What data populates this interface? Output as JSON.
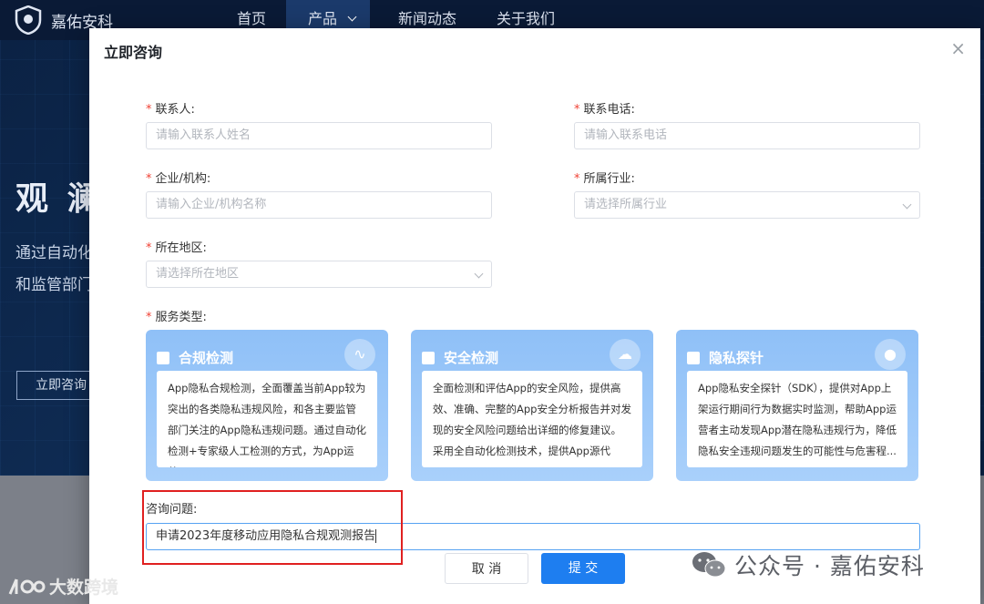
{
  "site": {
    "brand": "嘉佑安科",
    "nav": [
      "首页",
      "产品",
      "新闻动态",
      "关于我们"
    ],
    "hero_title": "观 澜",
    "hero_lines": [
      "通过自动化",
      "和监管部门"
    ],
    "hero_button": "立即咨询"
  },
  "modal": {
    "title": "立即咨询",
    "close_glyph": "×",
    "fields": {
      "contact": {
        "label": "联系人:",
        "placeholder": "请输入联系人姓名"
      },
      "phone": {
        "label": "联系电话:",
        "placeholder": "请输入联系电话"
      },
      "company": {
        "label": "企业/机构:",
        "placeholder": "请输入企业/机构名称"
      },
      "industry": {
        "label": "所属行业:",
        "placeholder": "请选择所属行业"
      },
      "region": {
        "label": "所在地区:",
        "placeholder": "请选择所在地区"
      },
      "service_type": {
        "label": "服务类型:"
      },
      "question": {
        "label": "咨询问题:",
        "value": "申请2023年度移动应用隐私合规观测报告"
      }
    },
    "required_mark": "*",
    "services": [
      {
        "title": "合规检测",
        "icon": "pulse-icon",
        "desc": "App隐私合规检测，全面覆盖当前App较为突出的各类隐私违规风险，和各主要监管部门关注的App隐私违规问题。通过自动化检测+专家级人工检测的方式，为App运营..."
      },
      {
        "title": "安全检测",
        "icon": "shield-cloud-icon",
        "desc": "全面检测和评估App的安全风险，提供高效、准确、完整的App安全分析报告并对发现的安全风险问题给出详细的修复建议。采用全自动化检测技术，提供App源代码、..."
      },
      {
        "title": "隐私探针",
        "icon": "lock-icon",
        "desc": "App隐私安全探针（SDK），提供对App上架运行期间行为数据实时监测，帮助App运营者主动发现App潜在隐私违规行为，降低隐私安全违规问题发生的可能性与危害程..."
      }
    ],
    "buttons": {
      "cancel": "取 消",
      "submit": "提 交"
    }
  },
  "watermarks": {
    "right": "公众号 · 嘉佑安科",
    "left": "大数跨境"
  },
  "colors": {
    "primary": "#1e7ef0",
    "highlight": "#e02020",
    "card": "#9ec9fa"
  }
}
